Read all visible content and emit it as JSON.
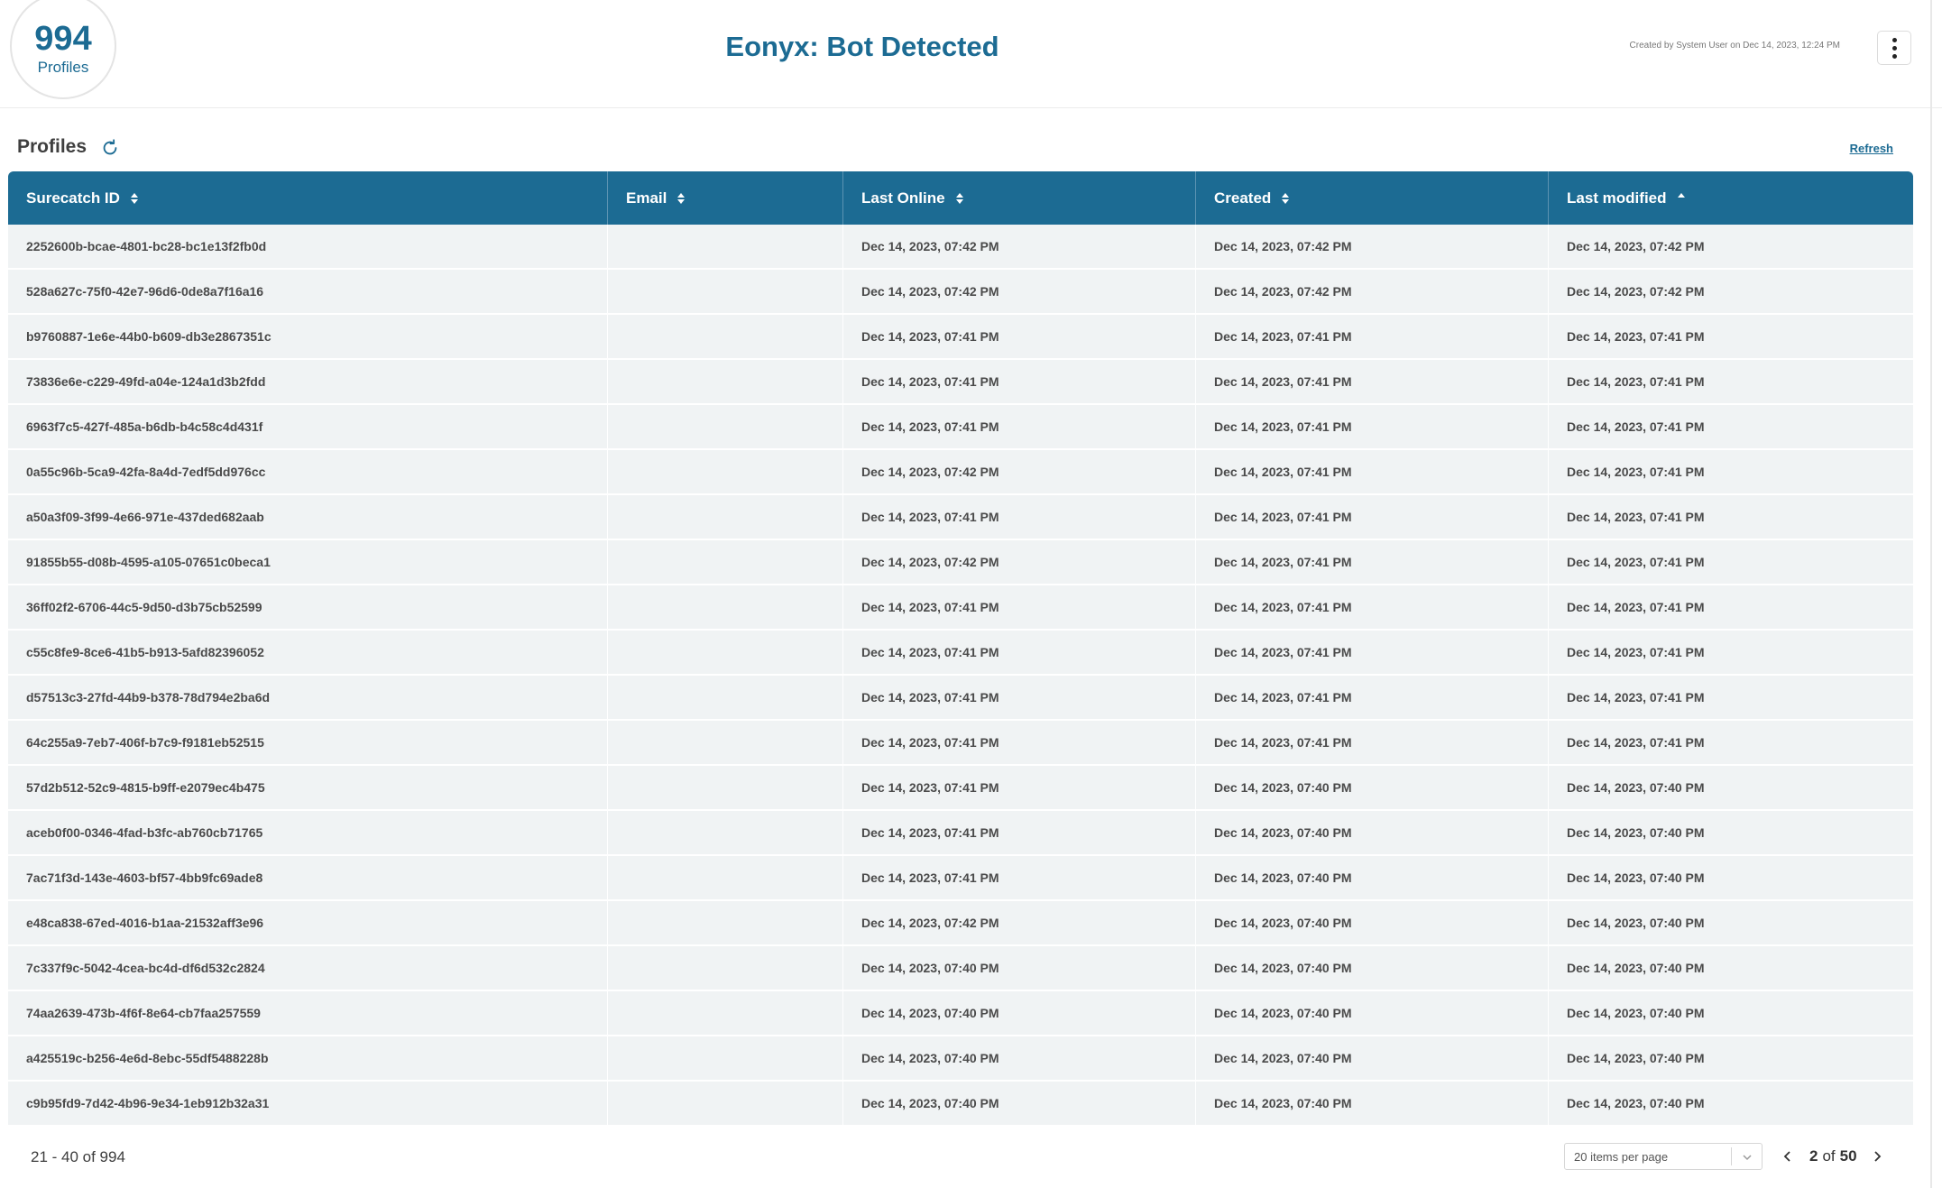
{
  "header": {
    "profile_count": "994",
    "profile_count_label": "Profiles",
    "title": "Eonyx: Bot Detected",
    "created_by": "Created by System User on Dec 14, 2023, 12:24 PM"
  },
  "section": {
    "title": "Profiles",
    "refresh_label": "Refresh"
  },
  "table": {
    "columns": [
      {
        "label": "Surecatch ID",
        "sort": "both"
      },
      {
        "label": "Email",
        "sort": "both"
      },
      {
        "label": "Last Online",
        "sort": "both"
      },
      {
        "label": "Created",
        "sort": "both"
      },
      {
        "label": "Last modified",
        "sort": "asc"
      }
    ],
    "rows": [
      [
        "2252600b-bcae-4801-bc28-bc1e13f2fb0d",
        "",
        "Dec 14, 2023, 07:42 PM",
        "Dec 14, 2023, 07:42 PM",
        "Dec 14, 2023, 07:42 PM"
      ],
      [
        "528a627c-75f0-42e7-96d6-0de8a7f16a16",
        "",
        "Dec 14, 2023, 07:42 PM",
        "Dec 14, 2023, 07:42 PM",
        "Dec 14, 2023, 07:42 PM"
      ],
      [
        "b9760887-1e6e-44b0-b609-db3e2867351c",
        "",
        "Dec 14, 2023, 07:41 PM",
        "Dec 14, 2023, 07:41 PM",
        "Dec 14, 2023, 07:41 PM"
      ],
      [
        "73836e6e-c229-49fd-a04e-124a1d3b2fdd",
        "",
        "Dec 14, 2023, 07:41 PM",
        "Dec 14, 2023, 07:41 PM",
        "Dec 14, 2023, 07:41 PM"
      ],
      [
        "6963f7c5-427f-485a-b6db-b4c58c4d431f",
        "",
        "Dec 14, 2023, 07:41 PM",
        "Dec 14, 2023, 07:41 PM",
        "Dec 14, 2023, 07:41 PM"
      ],
      [
        "0a55c96b-5ca9-42fa-8a4d-7edf5dd976cc",
        "",
        "Dec 14, 2023, 07:42 PM",
        "Dec 14, 2023, 07:41 PM",
        "Dec 14, 2023, 07:41 PM"
      ],
      [
        "a50a3f09-3f99-4e66-971e-437ded682aab",
        "",
        "Dec 14, 2023, 07:41 PM",
        "Dec 14, 2023, 07:41 PM",
        "Dec 14, 2023, 07:41 PM"
      ],
      [
        "91855b55-d08b-4595-a105-07651c0beca1",
        "",
        "Dec 14, 2023, 07:42 PM",
        "Dec 14, 2023, 07:41 PM",
        "Dec 14, 2023, 07:41 PM"
      ],
      [
        "36ff02f2-6706-44c5-9d50-d3b75cb52599",
        "",
        "Dec 14, 2023, 07:41 PM",
        "Dec 14, 2023, 07:41 PM",
        "Dec 14, 2023, 07:41 PM"
      ],
      [
        "c55c8fe9-8ce6-41b5-b913-5afd82396052",
        "",
        "Dec 14, 2023, 07:41 PM",
        "Dec 14, 2023, 07:41 PM",
        "Dec 14, 2023, 07:41 PM"
      ],
      [
        "d57513c3-27fd-44b9-b378-78d794e2ba6d",
        "",
        "Dec 14, 2023, 07:41 PM",
        "Dec 14, 2023, 07:41 PM",
        "Dec 14, 2023, 07:41 PM"
      ],
      [
        "64c255a9-7eb7-406f-b7c9-f9181eb52515",
        "",
        "Dec 14, 2023, 07:41 PM",
        "Dec 14, 2023, 07:41 PM",
        "Dec 14, 2023, 07:41 PM"
      ],
      [
        "57d2b512-52c9-4815-b9ff-e2079ec4b475",
        "",
        "Dec 14, 2023, 07:41 PM",
        "Dec 14, 2023, 07:40 PM",
        "Dec 14, 2023, 07:40 PM"
      ],
      [
        "aceb0f00-0346-4fad-b3fc-ab760cb71765",
        "",
        "Dec 14, 2023, 07:41 PM",
        "Dec 14, 2023, 07:40 PM",
        "Dec 14, 2023, 07:40 PM"
      ],
      [
        "7ac71f3d-143e-4603-bf57-4bb9fc69ade8",
        "",
        "Dec 14, 2023, 07:41 PM",
        "Dec 14, 2023, 07:40 PM",
        "Dec 14, 2023, 07:40 PM"
      ],
      [
        "e48ca838-67ed-4016-b1aa-21532aff3e96",
        "",
        "Dec 14, 2023, 07:42 PM",
        "Dec 14, 2023, 07:40 PM",
        "Dec 14, 2023, 07:40 PM"
      ],
      [
        "7c337f9c-5042-4cea-bc4d-df6d532c2824",
        "",
        "Dec 14, 2023, 07:40 PM",
        "Dec 14, 2023, 07:40 PM",
        "Dec 14, 2023, 07:40 PM"
      ],
      [
        "74aa2639-473b-4f6f-8e64-cb7faa257559",
        "",
        "Dec 14, 2023, 07:40 PM",
        "Dec 14, 2023, 07:40 PM",
        "Dec 14, 2023, 07:40 PM"
      ],
      [
        "a425519c-b256-4e6d-8ebc-55df5488228b",
        "",
        "Dec 14, 2023, 07:40 PM",
        "Dec 14, 2023, 07:40 PM",
        "Dec 14, 2023, 07:40 PM"
      ],
      [
        "c9b95fd9-7d42-4b96-9e34-1eb912b32a31",
        "",
        "Dec 14, 2023, 07:40 PM",
        "Dec 14, 2023, 07:40 PM",
        "Dec 14, 2023, 07:40 PM"
      ]
    ]
  },
  "footer": {
    "range_text": "21 - 40 of 994",
    "per_page": "20 items per page",
    "current_page": "2",
    "of_label": "of",
    "total_pages": "50"
  },
  "colors": {
    "brand": "#1c6b93",
    "row_background": "#f0f3f4"
  },
  "icons": {
    "menu": "kebab-icon",
    "reload": "reload-icon",
    "sort": "sort-icon",
    "prev": "chevron-left-icon",
    "next": "chevron-right-icon",
    "dropdown": "chevron-down-icon"
  }
}
